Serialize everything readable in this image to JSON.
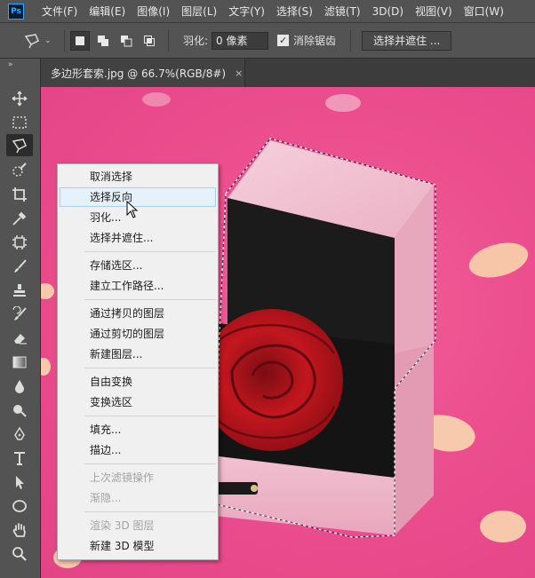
{
  "app": {
    "logo_text": "Ps",
    "menu": [
      "文件(F)",
      "编辑(E)",
      "图像(I)",
      "图层(L)",
      "文字(Y)",
      "选择(S)",
      "滤镜(T)",
      "3D(D)",
      "视图(V)",
      "窗口(W)"
    ]
  },
  "options": {
    "feather_label": "羽化:",
    "feather_value": "0 像素",
    "antialias_label": "消除锯齿",
    "antialias_checked": "✓",
    "select_mask_label": "选择并遮住 ..."
  },
  "document": {
    "tab_title": "多边形套索.jpg @ 66.7%(RGB/8#)",
    "tab_close": "×"
  },
  "context_menu": {
    "items": [
      {
        "label": "取消选择",
        "state": "normal"
      },
      {
        "label": "选择反向",
        "state": "hover"
      },
      {
        "label": "羽化...",
        "state": "normal"
      },
      {
        "label": "选择并遮住...",
        "state": "normal"
      },
      {
        "label": "存储选区...",
        "state": "normal"
      },
      {
        "label": "建立工作路径...",
        "state": "normal"
      },
      {
        "label": "通过拷贝的图层",
        "state": "normal"
      },
      {
        "label": "通过剪切的图层",
        "state": "normal"
      },
      {
        "label": "新建图层...",
        "state": "normal"
      },
      {
        "label": "自由变换",
        "state": "normal"
      },
      {
        "label": "变换选区",
        "state": "normal"
      },
      {
        "label": "填充...",
        "state": "normal"
      },
      {
        "label": "描边...",
        "state": "normal"
      },
      {
        "label": "上次滤镜操作",
        "state": "disabled"
      },
      {
        "label": "渐隐...",
        "state": "disabled"
      },
      {
        "label": "渲染 3D 图层",
        "state": "disabled"
      },
      {
        "label": "新建 3D 模型",
        "state": "normal"
      }
    ]
  },
  "tools": [
    "move-tool",
    "marquee-tool",
    "polygonal-lasso-tool",
    "quick-selection-tool",
    "crop-tool",
    "eyedropper-tool",
    "frame-tool",
    "brush-tool",
    "clone-stamp-tool",
    "history-brush-tool",
    "eraser-tool",
    "gradient-tool",
    "blur-tool",
    "dodge-tool",
    "pen-tool",
    "type-tool",
    "path-selection-tool",
    "ellipse-tool",
    "hand-tool",
    "zoom-tool"
  ],
  "colors": {
    "ui_panel": "#535353",
    "canvas_pink": "#ec4f8e",
    "menu_hover": "#e5f1fb",
    "ps_blue": "#31a8ff"
  }
}
